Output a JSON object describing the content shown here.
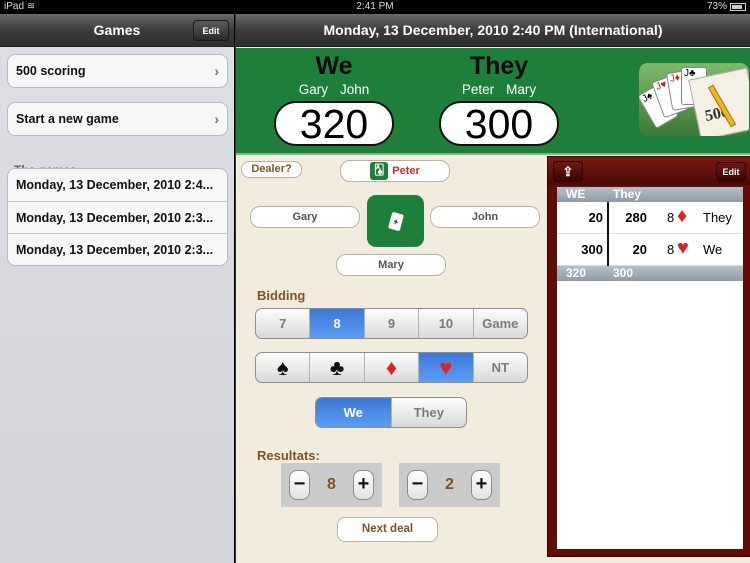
{
  "status_bar": {
    "device": "iPad",
    "time": "2:41 PM",
    "battery": "73%"
  },
  "left_panel": {
    "title": "Games",
    "edit_label": "Edit",
    "menu": [
      {
        "label": "500 scoring"
      },
      {
        "label": "Start a new game"
      }
    ],
    "section_header": "The games",
    "games": [
      {
        "label": "Monday, 13 December, 2010 2:4..."
      },
      {
        "label": "Monday, 13 December, 2010 2:3..."
      },
      {
        "label": "Monday, 13 December, 2010 2:3..."
      }
    ]
  },
  "main": {
    "title": "Monday, 13 December, 2010 2:40 PM (International)",
    "teams": [
      {
        "name": "We",
        "players": [
          "Gary",
          "John"
        ],
        "score": "320"
      },
      {
        "name": "They",
        "players": [
          "Peter",
          "Mary"
        ],
        "score": "300"
      }
    ],
    "logo_text": "500",
    "dealer_label": "Dealer?",
    "dealer_name": "Peter",
    "seats": {
      "left": "Gary",
      "right": "John",
      "bottom": "Mary"
    },
    "bidding_label": "Bidding",
    "bid_options": [
      "7",
      "8",
      "9",
      "10",
      "Game"
    ],
    "bid_selected": "8",
    "suit_options": [
      {
        "name": "spade",
        "glyph": "♠"
      },
      {
        "name": "club",
        "glyph": "♣"
      },
      {
        "name": "diamond",
        "glyph": "♦"
      },
      {
        "name": "heart",
        "glyph": "♥"
      },
      {
        "name": "no-trump",
        "glyph": "NT"
      }
    ],
    "suit_selected": "heart",
    "team_options": [
      "We",
      "They"
    ],
    "team_selected": "We",
    "results_label": "Resultats:",
    "results": {
      "we": "8",
      "they": "2"
    },
    "stepper_minus": "−",
    "stepper_plus": "+",
    "next_deal_label": "Next deal"
  },
  "score_sheet": {
    "edit_label": "Edit",
    "share_icon": "⇪",
    "headers": [
      "WE",
      "They"
    ],
    "rows": [
      {
        "we": "20",
        "they": "280",
        "bid": "8",
        "suit": "♦",
        "suit_name": "diamond",
        "team": "They"
      },
      {
        "we": "300",
        "they": "20",
        "bid": "8",
        "suit": "♥",
        "suit_name": "heart",
        "team": "We"
      }
    ],
    "totals": [
      "320",
      "300"
    ]
  }
}
